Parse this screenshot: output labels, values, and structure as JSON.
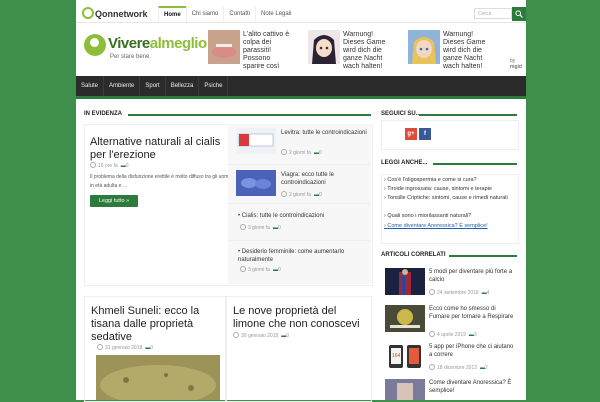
{
  "topbar": {
    "logo": "Qonnetwork",
    "nav": [
      "Home",
      "Chi siamo",
      "Contatti",
      "Note Legali"
    ],
    "search_placeholder": "Cerca"
  },
  "header": {
    "brand_name_1": "Vivere",
    "brand_name_2": "almeglio",
    "brand_tagline": "Per stare bene.",
    "ads": [
      "L'alito cattivo è colpa dei parassiti! Possono sparire così",
      "Warnung! Dieses Game wird dich die ganze Nacht wach halten!",
      "Warnung! Dieses Game wird dich die ganze Nacht wach halten!"
    ],
    "ad_by": "by",
    "ad_network": "mgid"
  },
  "mainnav": [
    "Salute",
    "Ambiente",
    "Sport",
    "Bellezza",
    "Psiche"
  ],
  "evidenza": {
    "heading": "IN EVIDENZA",
    "featured_title": "Alternative naturali al cialis per l'erezione",
    "featured_time": "16 ore fa",
    "featured_comments": "0",
    "featured_excerpt": "Il problema della disfunzione erettile è molto diffuso tra gli uomini in età adulta e …",
    "more_label": "Leggi tutto »",
    "list": [
      {
        "title": "Levitra: tutte le controindicazioni",
        "time": "2 giorni fa",
        "comments": "0"
      },
      {
        "title": "Viagra: ecco tutte le controindicazioni",
        "time": "2 giorni fa",
        "comments": "0"
      },
      {
        "title": "Cialis: tutte le controindicazioni",
        "time": "3 giorni fa",
        "comments": "0"
      },
      {
        "title": "Desiderio femminile: come aumentarlo naturalmente",
        "time": "3 giorni fa",
        "comments": "0"
      }
    ]
  },
  "cards": [
    {
      "title": "Khmeli Suneli: ecco la tisana dalle proprietà sedative",
      "date": "31 gennaio 2018",
      "comments": "0"
    },
    {
      "title": "Le nove proprietà del limone che non conoscevi",
      "date": "30 gennaio 2018",
      "comments": "0"
    }
  ],
  "sidebar": {
    "seguici_heading": "SEGUICI SU...",
    "google_label": "g+",
    "facebook_label": "f",
    "leggi_heading": "LEGGI ANCHE...",
    "leggi": [
      "Cos'è l'oligospermia e come si cura?",
      "Tiroide ingrossata: cause, sintomi e terapie",
      "Tonsille Criptiche: sintomi, cause e rimedi naturali",
      "Quali sono i miorilassanti naturali?",
      "Come diventare Anoressica? È semplice!"
    ],
    "correlati_heading": "ARTICOLI CORRELATI",
    "correlati": [
      {
        "title": "5 modi per diventare più forte a calcio",
        "date": "24 settembre 2018",
        "comments": "4"
      },
      {
        "title": "Ecco come ho smesso di Fumare per tornare a Respirare",
        "date": "4 aprile 2019",
        "comments": "3"
      },
      {
        "title": "5 app per iPhone che ci aiutano a correre",
        "date": "18 dicembre 2013",
        "comments": "2"
      },
      {
        "title": "Come diventare Anoressica? È semplice!",
        "date": "",
        "comments": ""
      }
    ]
  },
  "colors": {
    "accent": "#2d7a3d",
    "lime": "#8dbe3a",
    "nav_bg": "#2b2b2b",
    "page_bg": "#3e8e4c"
  }
}
